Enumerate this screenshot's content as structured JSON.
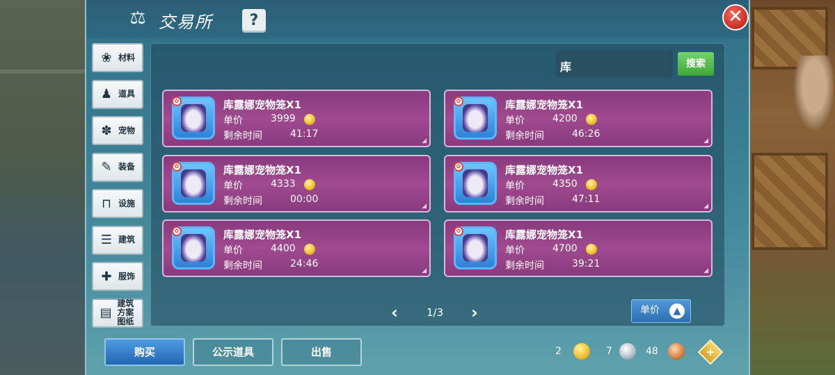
{
  "header": {
    "title": "交易所",
    "help": "?",
    "close": "✕"
  },
  "categories": [
    {
      "label": "材料",
      "icon": "materials-icon",
      "glyph": "❀"
    },
    {
      "label": "道具",
      "icon": "item-icon",
      "glyph": "♟"
    },
    {
      "label": "宠物",
      "icon": "paw-icon",
      "glyph": "✽"
    },
    {
      "label": "装备",
      "icon": "equipment-icon",
      "glyph": "✎"
    },
    {
      "label": "设施",
      "icon": "facility-icon",
      "glyph": "⊓"
    },
    {
      "label": "建筑",
      "icon": "building-icon",
      "glyph": "☰"
    },
    {
      "label": "服饰",
      "icon": "clothing-icon",
      "glyph": "✚"
    },
    {
      "label": "建筑方案图纸",
      "icon": "blueprint-icon",
      "glyph": "▤"
    }
  ],
  "search": {
    "value": "库",
    "button": "搜索"
  },
  "listing_labels": {
    "price": "单价",
    "time_left": "剩余时间"
  },
  "items": [
    {
      "name": "库露娜宠物笼X1",
      "price": "3999",
      "time": "41:17"
    },
    {
      "name": "库露娜宠物笼X1",
      "price": "4200",
      "time": "46:26"
    },
    {
      "name": "库露娜宠物笼X1",
      "price": "4333",
      "time": "00:00"
    },
    {
      "name": "库露娜宠物笼X1",
      "price": "4350",
      "time": "47:11"
    },
    {
      "name": "库露娜宠物笼X1",
      "price": "4400",
      "time": "24:46"
    },
    {
      "name": "库露娜宠物笼X1",
      "price": "4700",
      "time": "39:21"
    }
  ],
  "pager": {
    "text": "1/3",
    "prev": "‹",
    "next": "›"
  },
  "sort": {
    "label": "单价"
  },
  "bottom": {
    "buy": "购买",
    "showcase": "公示道具",
    "sell": "出售"
  },
  "currency": {
    "gold": "2",
    "silver": "7",
    "copper": "48",
    "plus": "+"
  }
}
